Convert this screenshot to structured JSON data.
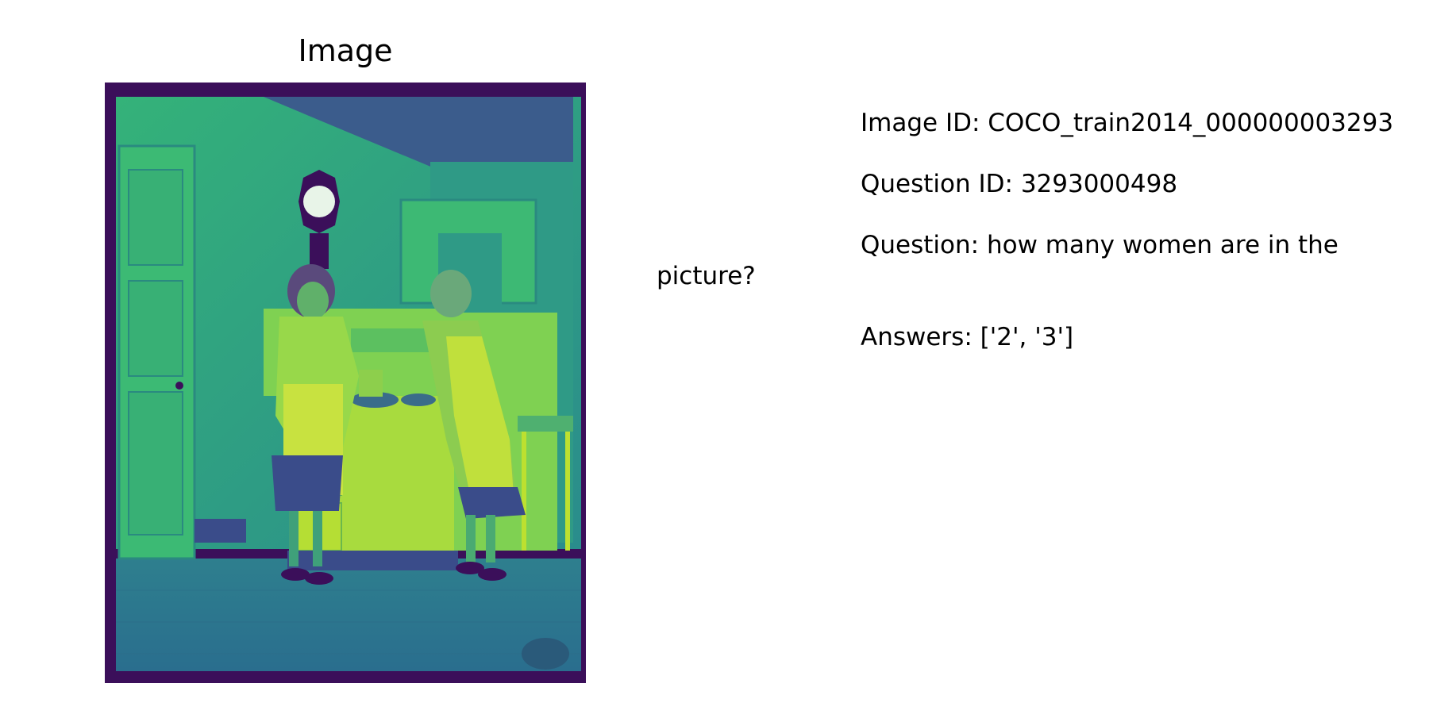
{
  "figure": {
    "title": "Image",
    "photo_description": "Monochrome viridis-colored photo of two women in aprons cooking at a stove in a kitchen, with a wall clock, door and cabinets"
  },
  "info": {
    "image_id": "Image ID: COCO_train2014_000000003293",
    "question_id": "Question ID: 3293000498",
    "question": "Question: how many women are in the picture?",
    "answers": "Answers: ['2', '3']"
  },
  "colors": {
    "dark": "#3b0f5a",
    "mid": "#2a9a8a",
    "light": "#b8e03a"
  }
}
